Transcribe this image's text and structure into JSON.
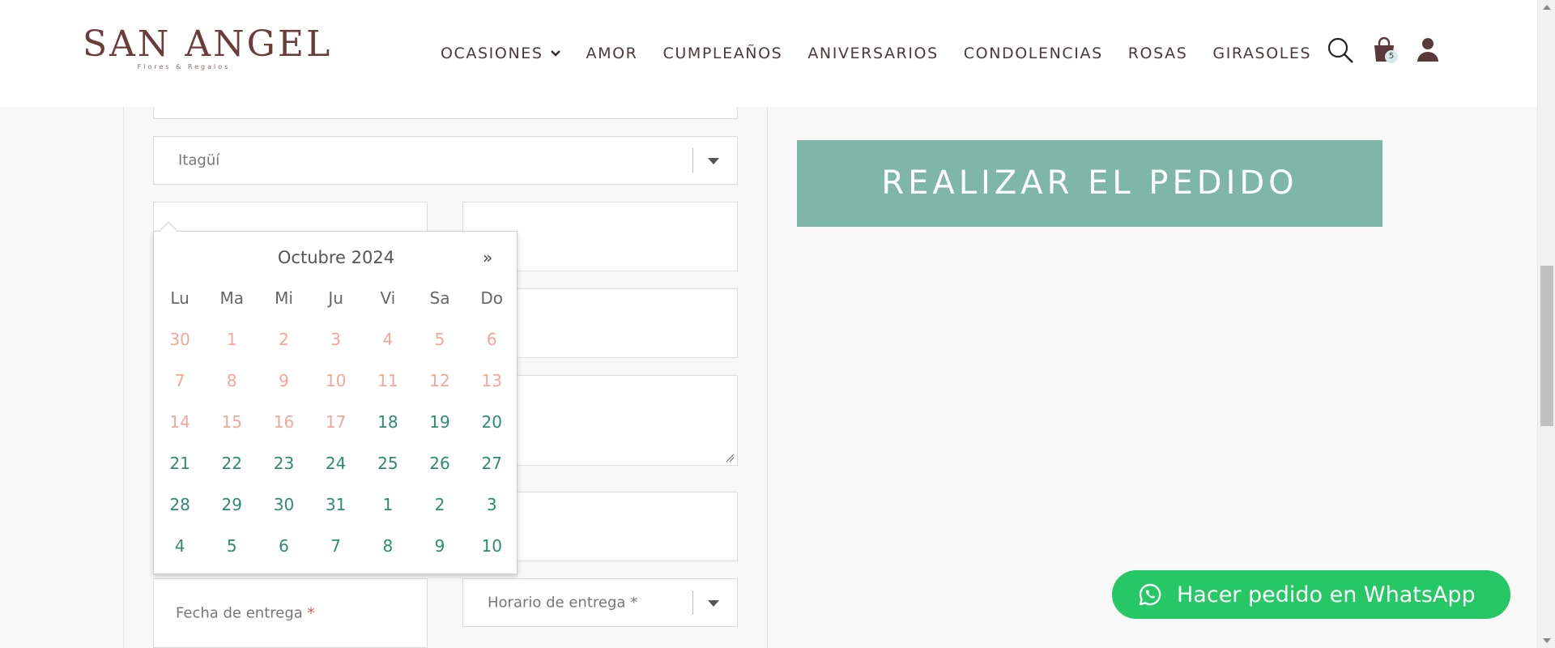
{
  "header": {
    "logo_text": "SAN ANGEL",
    "logo_subtitle": "Flores & Regalos",
    "nav": [
      {
        "label": "OCASIONES",
        "has_dropdown": true
      },
      {
        "label": "AMOR"
      },
      {
        "label": "CUMPLEAÑOS"
      },
      {
        "label": "ANIVERSARIOS"
      },
      {
        "label": "CONDOLENCIAS"
      },
      {
        "label": "ROSAS"
      },
      {
        "label": "GIRASOLES"
      }
    ],
    "icons": [
      "search-icon",
      "cart-icon",
      "user-icon"
    ],
    "cart_count": "5"
  },
  "form": {
    "city_select": "Itagüí",
    "delivery_date_placeholder": "Fecha de entrega",
    "delivery_time_placeholder": "Horario de entrega",
    "required_mark": "*"
  },
  "order_button": "REALIZAR EL PEDIDO",
  "calendar": {
    "title": "Octubre 2024",
    "next_label": "»",
    "weekdays": [
      "Lu",
      "Ma",
      "Mi",
      "Ju",
      "Vi",
      "Sa",
      "Do"
    ],
    "weeks": [
      [
        {
          "d": "30",
          "on": false
        },
        {
          "d": "1",
          "on": false
        },
        {
          "d": "2",
          "on": false
        },
        {
          "d": "3",
          "on": false
        },
        {
          "d": "4",
          "on": false
        },
        {
          "d": "5",
          "on": false
        },
        {
          "d": "6",
          "on": false
        }
      ],
      [
        {
          "d": "7",
          "on": false
        },
        {
          "d": "8",
          "on": false
        },
        {
          "d": "9",
          "on": false
        },
        {
          "d": "10",
          "on": false
        },
        {
          "d": "11",
          "on": false
        },
        {
          "d": "12",
          "on": false
        },
        {
          "d": "13",
          "on": false
        }
      ],
      [
        {
          "d": "14",
          "on": false
        },
        {
          "d": "15",
          "on": false
        },
        {
          "d": "16",
          "on": false
        },
        {
          "d": "17",
          "on": false
        },
        {
          "d": "18",
          "on": true
        },
        {
          "d": "19",
          "on": true
        },
        {
          "d": "20",
          "on": true
        }
      ],
      [
        {
          "d": "21",
          "on": true
        },
        {
          "d": "22",
          "on": true
        },
        {
          "d": "23",
          "on": true
        },
        {
          "d": "24",
          "on": true
        },
        {
          "d": "25",
          "on": true
        },
        {
          "d": "26",
          "on": true
        },
        {
          "d": "27",
          "on": true
        }
      ],
      [
        {
          "d": "28",
          "on": true
        },
        {
          "d": "29",
          "on": true
        },
        {
          "d": "30",
          "on": true
        },
        {
          "d": "31",
          "on": true
        },
        {
          "d": "1",
          "on": true
        },
        {
          "d": "2",
          "on": true
        },
        {
          "d": "3",
          "on": true
        }
      ],
      [
        {
          "d": "4",
          "on": true
        },
        {
          "d": "5",
          "on": true
        },
        {
          "d": "6",
          "on": true
        },
        {
          "d": "7",
          "on": true
        },
        {
          "d": "8",
          "on": true
        },
        {
          "d": "9",
          "on": true
        },
        {
          "d": "10",
          "on": true
        }
      ]
    ]
  },
  "whatsapp_button": "Hacer pedido en WhatsApp",
  "colors": {
    "accent_green": "#7eb6a8",
    "whatsapp_green": "#25c864",
    "day_enabled": "#2e8b73",
    "day_disabled": "#f2a79b",
    "brand": "#6a3d3a"
  }
}
